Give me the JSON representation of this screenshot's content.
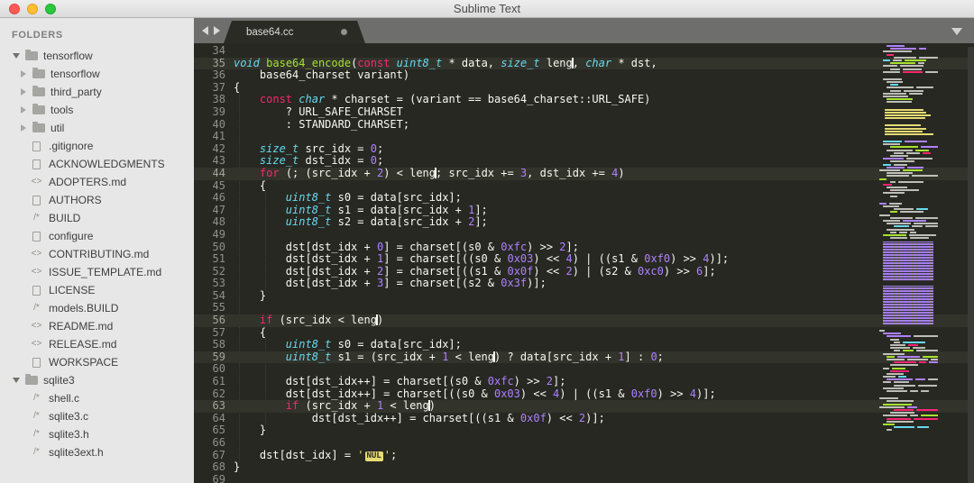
{
  "window": {
    "title": "Sublime Text"
  },
  "sidebar": {
    "header": "FOLDERS",
    "icon_glyphs": {
      "markup": "<>",
      "source": "/*"
    },
    "items": [
      {
        "label": "tensorflow",
        "icon": "folder-open",
        "level": 1,
        "arrow": "expanded"
      },
      {
        "label": "tensorflow",
        "icon": "folder",
        "level": 2,
        "arrow": "collapsed"
      },
      {
        "label": "third_party",
        "icon": "folder",
        "level": 2,
        "arrow": "collapsed"
      },
      {
        "label": "tools",
        "icon": "folder",
        "level": 2,
        "arrow": "collapsed"
      },
      {
        "label": "util",
        "icon": "folder",
        "level": 2,
        "arrow": "collapsed"
      },
      {
        "label": ".gitignore",
        "icon": "doc",
        "level": 2,
        "arrow": null
      },
      {
        "label": "ACKNOWLEDGMENTS",
        "icon": "doc",
        "level": 2,
        "arrow": null
      },
      {
        "label": "ADOPTERS.md",
        "icon": "markup",
        "level": 2,
        "arrow": null
      },
      {
        "label": "AUTHORS",
        "icon": "doc",
        "level": 2,
        "arrow": null
      },
      {
        "label": "BUILD",
        "icon": "source",
        "level": 2,
        "arrow": null
      },
      {
        "label": "configure",
        "icon": "doc",
        "level": 2,
        "arrow": null
      },
      {
        "label": "CONTRIBUTING.md",
        "icon": "markup",
        "level": 2,
        "arrow": null
      },
      {
        "label": "ISSUE_TEMPLATE.md",
        "icon": "markup",
        "level": 2,
        "arrow": null
      },
      {
        "label": "LICENSE",
        "icon": "doc",
        "level": 2,
        "arrow": null
      },
      {
        "label": "models.BUILD",
        "icon": "source",
        "level": 2,
        "arrow": null
      },
      {
        "label": "README.md",
        "icon": "markup",
        "level": 2,
        "arrow": null
      },
      {
        "label": "RELEASE.md",
        "icon": "markup",
        "level": 2,
        "arrow": null
      },
      {
        "label": "WORKSPACE",
        "icon": "doc",
        "level": 2,
        "arrow": null
      },
      {
        "label": "sqlite3",
        "icon": "folder-open",
        "level": 1,
        "arrow": "expanded"
      },
      {
        "label": "shell.c",
        "icon": "source",
        "level": 2,
        "arrow": null
      },
      {
        "label": "sqlite3.c",
        "icon": "source",
        "level": 2,
        "arrow": null
      },
      {
        "label": "sqlite3.h",
        "icon": "source",
        "level": 2,
        "arrow": null
      },
      {
        "label": "sqlite3ext.h",
        "icon": "source",
        "level": 2,
        "arrow": null
      }
    ]
  },
  "tabbar": {
    "tabs": [
      {
        "label": "base64.cc",
        "active": true,
        "dirty": true
      }
    ]
  },
  "colors": {
    "editor_bg": "#272822",
    "line_highlight": "#32332b",
    "keyword": "#f92672",
    "type": "#66d9ef",
    "function": "#a6e22e",
    "number": "#ae81ff",
    "string": "#e6db74",
    "plain": "#f8f8f2",
    "gutter": "#90918b"
  },
  "code": {
    "first_line": 34,
    "last_line": 69,
    "lines": [
      {
        "n": 34,
        "hl": false,
        "t": []
      },
      {
        "n": 35,
        "hl": true,
        "t": [
          [
            "void",
            "type"
          ],
          [
            " ",
            "p"
          ],
          [
            "base64_encode",
            "fn"
          ],
          [
            "(",
            "p"
          ],
          [
            "const",
            "kw"
          ],
          [
            " ",
            "p"
          ],
          [
            "uint8_t",
            "type"
          ],
          [
            " * data, ",
            "p"
          ],
          [
            "size_t",
            "type"
          ],
          [
            " leng",
            "p"
          ],
          [
            "",
            "cur"
          ],
          [
            ", ",
            "p"
          ],
          [
            "char",
            "type"
          ],
          [
            " * dst,",
            "p"
          ]
        ]
      },
      {
        "n": 36,
        "hl": false,
        "t": [
          [
            "    base64_charset variant)",
            "p"
          ]
        ]
      },
      {
        "n": 37,
        "hl": false,
        "t": [
          [
            "{",
            "p"
          ]
        ]
      },
      {
        "n": 38,
        "hl": false,
        "t": [
          [
            "    ",
            "p"
          ],
          [
            "const",
            "kw"
          ],
          [
            " ",
            "p"
          ],
          [
            "char",
            "type"
          ],
          [
            " * charset = (variant == base64_charset::URL_SAFE)",
            "p"
          ]
        ]
      },
      {
        "n": 39,
        "hl": false,
        "t": [
          [
            "        ? URL_SAFE_CHARSET",
            "p"
          ]
        ]
      },
      {
        "n": 40,
        "hl": false,
        "t": [
          [
            "        : STANDARD_CHARSET;",
            "p"
          ]
        ]
      },
      {
        "n": 41,
        "hl": false,
        "t": []
      },
      {
        "n": 42,
        "hl": false,
        "t": [
          [
            "    ",
            "p"
          ],
          [
            "size_t",
            "type"
          ],
          [
            " src_idx = ",
            "p"
          ],
          [
            "0",
            "num"
          ],
          [
            ";",
            "p"
          ]
        ]
      },
      {
        "n": 43,
        "hl": false,
        "t": [
          [
            "    ",
            "p"
          ],
          [
            "size_t",
            "type"
          ],
          [
            " dst_idx = ",
            "p"
          ],
          [
            "0",
            "num"
          ],
          [
            ";",
            "p"
          ]
        ]
      },
      {
        "n": 44,
        "hl": true,
        "t": [
          [
            "    ",
            "p"
          ],
          [
            "for",
            "kw"
          ],
          [
            " (; (src_idx + ",
            "p"
          ],
          [
            "2",
            "num"
          ],
          [
            ") < leng",
            "p"
          ],
          [
            "",
            "cur"
          ],
          [
            "; src_idx += ",
            "p"
          ],
          [
            "3",
            "num"
          ],
          [
            ", dst_idx += ",
            "p"
          ],
          [
            "4",
            "num"
          ],
          [
            ")",
            "p"
          ]
        ]
      },
      {
        "n": 45,
        "hl": false,
        "t": [
          [
            "    {",
            "p"
          ]
        ]
      },
      {
        "n": 46,
        "hl": false,
        "t": [
          [
            "        ",
            "p"
          ],
          [
            "uint8_t",
            "type"
          ],
          [
            " s0 = data[src_idx];",
            "p"
          ]
        ]
      },
      {
        "n": 47,
        "hl": false,
        "t": [
          [
            "        ",
            "p"
          ],
          [
            "uint8_t",
            "type"
          ],
          [
            " s1 = data[src_idx + ",
            "p"
          ],
          [
            "1",
            "num"
          ],
          [
            "];",
            "p"
          ]
        ]
      },
      {
        "n": 48,
        "hl": false,
        "t": [
          [
            "        ",
            "p"
          ],
          [
            "uint8_t",
            "type"
          ],
          [
            " s2 = data[src_idx + ",
            "p"
          ],
          [
            "2",
            "num"
          ],
          [
            "];",
            "p"
          ]
        ]
      },
      {
        "n": 49,
        "hl": false,
        "t": []
      },
      {
        "n": 50,
        "hl": false,
        "t": [
          [
            "        dst[dst_idx + ",
            "p"
          ],
          [
            "0",
            "num"
          ],
          [
            "] = charset[(s0 & ",
            "p"
          ],
          [
            "0xfc",
            "num"
          ],
          [
            ") >> ",
            "p"
          ],
          [
            "2",
            "num"
          ],
          [
            "];",
            "p"
          ]
        ]
      },
      {
        "n": 51,
        "hl": false,
        "t": [
          [
            "        dst[dst_idx + ",
            "p"
          ],
          [
            "1",
            "num"
          ],
          [
            "] = charset[((s0 & ",
            "p"
          ],
          [
            "0x03",
            "num"
          ],
          [
            ") << ",
            "p"
          ],
          [
            "4",
            "num"
          ],
          [
            ") | ((s1 & ",
            "p"
          ],
          [
            "0xf0",
            "num"
          ],
          [
            ") >> ",
            "p"
          ],
          [
            "4",
            "num"
          ],
          [
            ")];",
            "p"
          ]
        ]
      },
      {
        "n": 52,
        "hl": false,
        "t": [
          [
            "        dst[dst_idx + ",
            "p"
          ],
          [
            "2",
            "num"
          ],
          [
            "] = charset[((s1 & ",
            "p"
          ],
          [
            "0x0f",
            "num"
          ],
          [
            ") << ",
            "p"
          ],
          [
            "2",
            "num"
          ],
          [
            ") | (s2 & ",
            "p"
          ],
          [
            "0xc0",
            "num"
          ],
          [
            ") >> ",
            "p"
          ],
          [
            "6",
            "num"
          ],
          [
            "];",
            "p"
          ]
        ]
      },
      {
        "n": 53,
        "hl": false,
        "t": [
          [
            "        dst[dst_idx + ",
            "p"
          ],
          [
            "3",
            "num"
          ],
          [
            "] = charset[(s2 & ",
            "p"
          ],
          [
            "0x3f",
            "num"
          ],
          [
            ")];",
            "p"
          ]
        ]
      },
      {
        "n": 54,
        "hl": false,
        "t": [
          [
            "    }",
            "p"
          ]
        ]
      },
      {
        "n": 55,
        "hl": false,
        "t": []
      },
      {
        "n": 56,
        "hl": true,
        "t": [
          [
            "    ",
            "p"
          ],
          [
            "if",
            "kw"
          ],
          [
            " (src_idx < leng",
            "p"
          ],
          [
            "",
            "cur"
          ],
          [
            ")",
            "p"
          ]
        ]
      },
      {
        "n": 57,
        "hl": false,
        "t": [
          [
            "    {",
            "p"
          ]
        ]
      },
      {
        "n": 58,
        "hl": false,
        "t": [
          [
            "        ",
            "p"
          ],
          [
            "uint8_t",
            "type"
          ],
          [
            " s0 = data[src_idx];",
            "p"
          ]
        ]
      },
      {
        "n": 59,
        "hl": true,
        "t": [
          [
            "        ",
            "p"
          ],
          [
            "uint8_t",
            "type"
          ],
          [
            " s1 = (src_idx + ",
            "p"
          ],
          [
            "1",
            "num"
          ],
          [
            " < leng",
            "p"
          ],
          [
            "",
            "cur"
          ],
          [
            ") ? data[src_idx + ",
            "p"
          ],
          [
            "1",
            "num"
          ],
          [
            "] : ",
            "p"
          ],
          [
            "0",
            "num"
          ],
          [
            ";",
            "p"
          ]
        ]
      },
      {
        "n": 60,
        "hl": false,
        "t": []
      },
      {
        "n": 61,
        "hl": false,
        "t": [
          [
            "        dst[dst_idx++] = charset[(s0 & ",
            "p"
          ],
          [
            "0xfc",
            "num"
          ],
          [
            ") >> ",
            "p"
          ],
          [
            "2",
            "num"
          ],
          [
            "];",
            "p"
          ]
        ]
      },
      {
        "n": 62,
        "hl": false,
        "t": [
          [
            "        dst[dst_idx++] = charset[((s0 & ",
            "p"
          ],
          [
            "0x03",
            "num"
          ],
          [
            ") << ",
            "p"
          ],
          [
            "4",
            "num"
          ],
          [
            ") | ((s1 & ",
            "p"
          ],
          [
            "0xf0",
            "num"
          ],
          [
            ") >> ",
            "p"
          ],
          [
            "4",
            "num"
          ],
          [
            ")];",
            "p"
          ]
        ]
      },
      {
        "n": 63,
        "hl": true,
        "t": [
          [
            "        ",
            "p"
          ],
          [
            "if",
            "kw"
          ],
          [
            " (src_idx + ",
            "p"
          ],
          [
            "1",
            "num"
          ],
          [
            " < leng",
            "p"
          ],
          [
            "",
            "cur"
          ],
          [
            ")",
            "p"
          ]
        ]
      },
      {
        "n": 64,
        "hl": false,
        "t": [
          [
            "            dst[dst_idx++] = charset[((s1 & ",
            "p"
          ],
          [
            "0x0f",
            "num"
          ],
          [
            ") << ",
            "p"
          ],
          [
            "2",
            "num"
          ],
          [
            ")];",
            "p"
          ]
        ]
      },
      {
        "n": 65,
        "hl": false,
        "t": [
          [
            "    }",
            "p"
          ]
        ]
      },
      {
        "n": 66,
        "hl": false,
        "t": []
      },
      {
        "n": 67,
        "hl": false,
        "t": [
          [
            "    dst[dst_idx] = ",
            "p"
          ],
          [
            "'",
            "str"
          ],
          [
            "NUL",
            "ctrl"
          ],
          [
            "'",
            "str"
          ],
          [
            ";",
            "p"
          ]
        ]
      },
      {
        "n": 68,
        "hl": false,
        "t": [
          [
            "}",
            "p"
          ]
        ]
      },
      {
        "n": 69,
        "hl": false,
        "t": []
      }
    ]
  }
}
